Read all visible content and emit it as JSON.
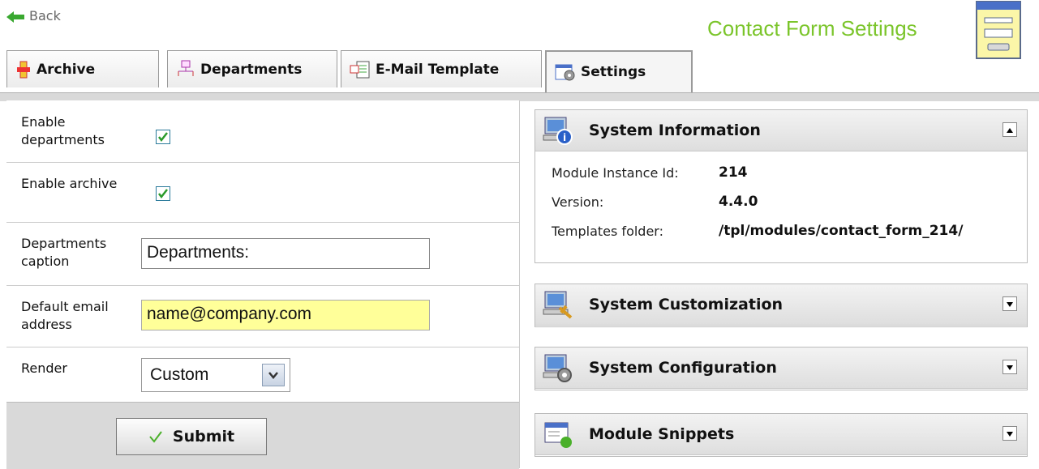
{
  "back_label": "Back",
  "page_title": "Contact Form Settings",
  "tabs": [
    {
      "label": "Archive",
      "icon": "archive-icon"
    },
    {
      "label": "Departments",
      "icon": "departments-icon"
    },
    {
      "label": "E-Mail Template",
      "icon": "email-template-icon"
    },
    {
      "label": "Settings",
      "icon": "settings-icon",
      "active": true
    }
  ],
  "form": {
    "enable_departments": {
      "label": "Enable departments",
      "checked": true
    },
    "enable_archive": {
      "label": "Enable archive",
      "checked": true
    },
    "departments_caption": {
      "label": "Departments caption",
      "value": "Departments:"
    },
    "default_email": {
      "label": "Default email address",
      "value": "name@company.com"
    },
    "render": {
      "label": "Render",
      "value": "Custom"
    },
    "submit_label": "Submit"
  },
  "panels": {
    "system_information": {
      "title": "System Information",
      "rows": [
        {
          "key": "Module Instance Id:",
          "value": "214"
        },
        {
          "key": "Version:",
          "value": "4.4.0"
        },
        {
          "key": "Templates folder:",
          "value": "/tpl/modules/contact_form_214/"
        }
      ]
    },
    "system_customization": {
      "title": "System Customization"
    },
    "system_configuration": {
      "title": "System Configuration"
    },
    "module_snippets": {
      "title": "Module Snippets"
    }
  },
  "colors": {
    "title": "#7bc52b",
    "highlight_field": "#ffff99"
  }
}
